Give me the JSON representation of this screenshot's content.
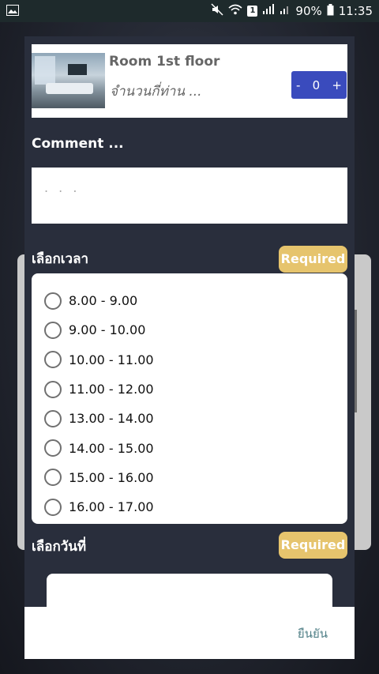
{
  "status_bar": {
    "battery_percent": "90%",
    "time": "11:35",
    "sim_label": "1"
  },
  "room": {
    "title": "Room 1st floor",
    "subtitle": "จำนวนกี่ท่าน ...",
    "stepper": {
      "minus": "-",
      "value": "0",
      "plus": "+"
    }
  },
  "comment": {
    "label": "Comment ...",
    "placeholder": ". . ."
  },
  "time_section": {
    "label": "เลือกเวลา",
    "required": "Required",
    "options": [
      "8.00 - 9.00",
      "9.00 - 10.00",
      "10.00 - 11.00",
      "11.00 - 12.00",
      "13.00 - 14.00",
      "14.00 - 15.00",
      "15.00 - 16.00",
      "16.00 - 17.00"
    ]
  },
  "date_section": {
    "label": "เลือกวันที่",
    "required": "Required"
  },
  "footer": {
    "confirm": "ยืนยัน"
  },
  "colors": {
    "accent": "#3a4bbd",
    "required": "#e6c46d",
    "dialog_bg": "#292e3c",
    "confirm_text": "#4f7f86"
  }
}
